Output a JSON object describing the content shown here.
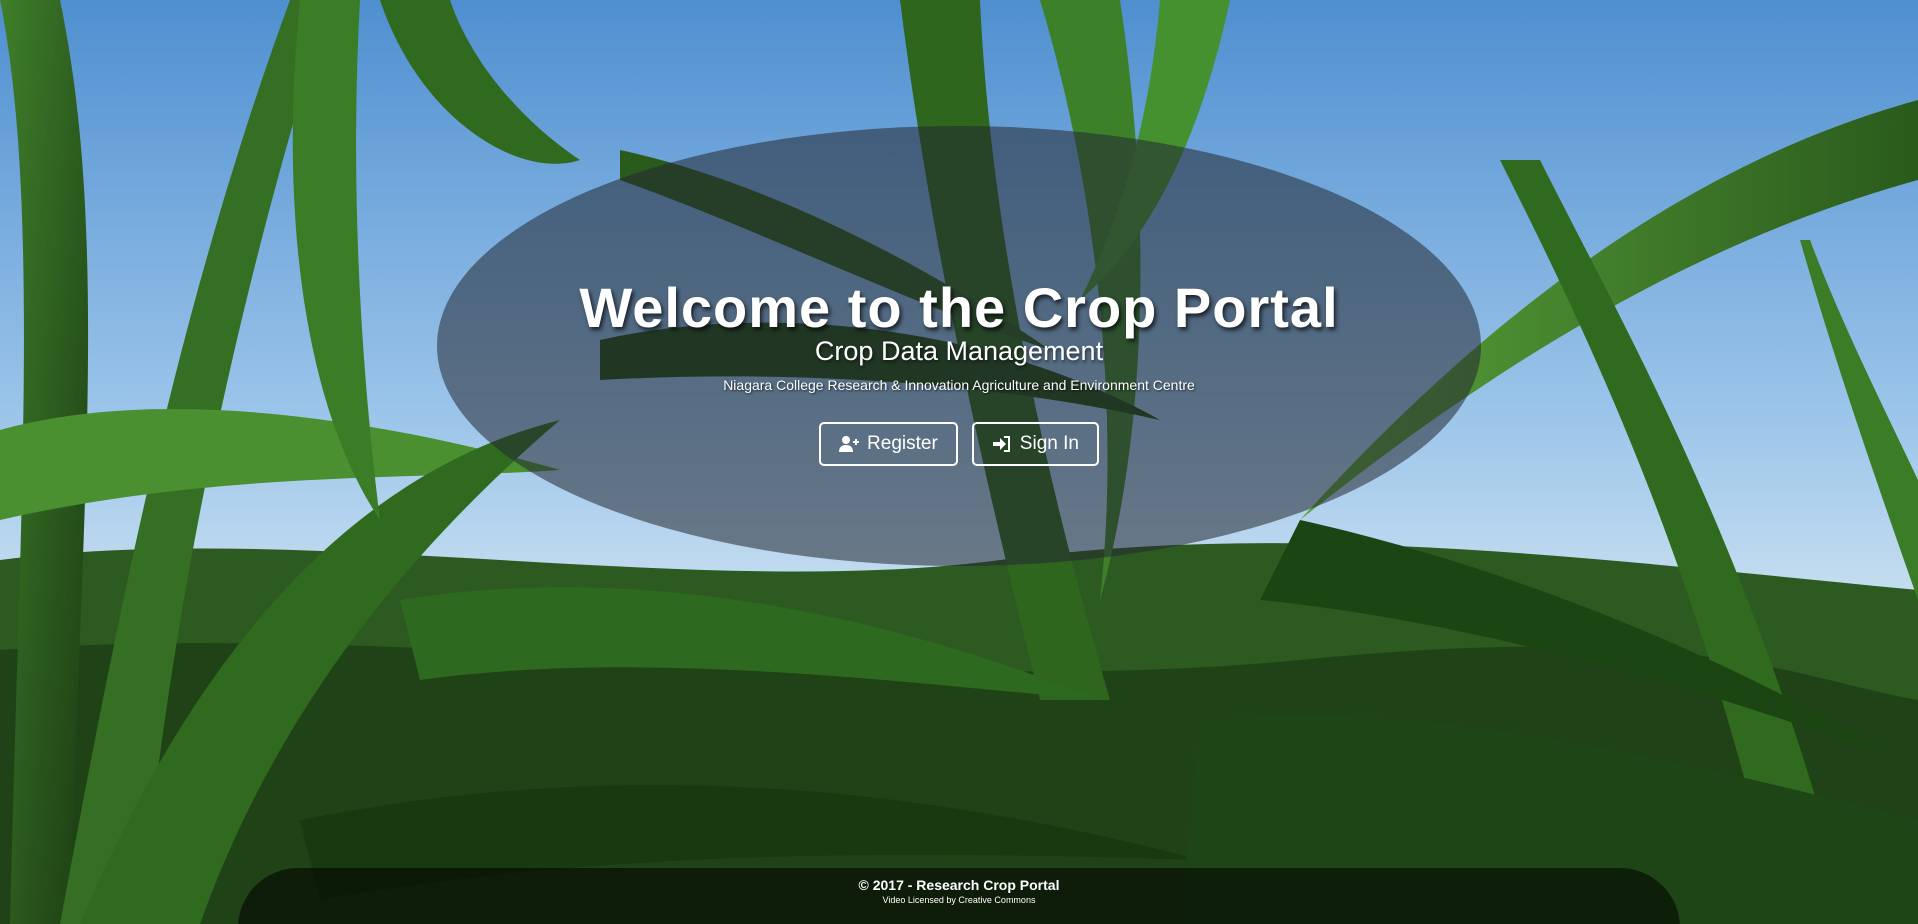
{
  "hero": {
    "title": "Welcome to the Crop Portal",
    "subtitle": "Crop Data Management",
    "tagline": "Niagara College Research & Innovation Agriculture and Environment Centre",
    "background_image": "corn-field-leaves-blue-sky"
  },
  "actions": {
    "register_label": "Register",
    "register_icon": "user-plus-icon",
    "signin_label": "Sign In",
    "signin_icon": "sign-in-icon"
  },
  "footer": {
    "copyright": "© 2017 - Research Crop Portal",
    "license": "Video Licensed by Creative Commons"
  },
  "colors": {
    "text": "#ffffff",
    "overlay": "#232832",
    "sky": "#5b9bd5",
    "leaf": "#2f5a22"
  }
}
